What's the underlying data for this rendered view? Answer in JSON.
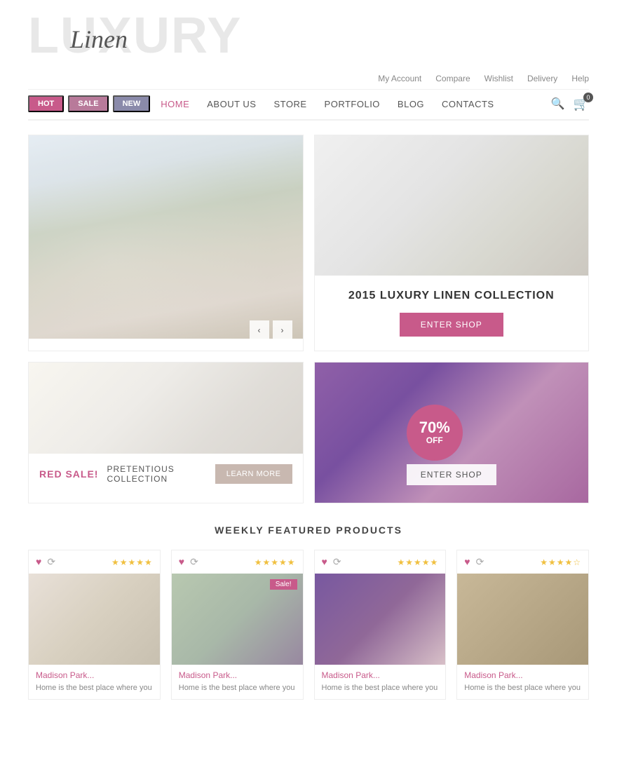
{
  "header": {
    "logo_bg": "LUXURY",
    "logo_script": "Linen"
  },
  "topbar": {
    "items": [
      "My Account",
      "Compare",
      "Wishlist",
      "Delivery",
      "Help"
    ]
  },
  "nav": {
    "badges": [
      {
        "label": "HOT",
        "class": "badge-hot"
      },
      {
        "label": "SALE",
        "class": "badge-sale"
      },
      {
        "label": "NEW",
        "class": "badge-new"
      }
    ],
    "links": [
      {
        "label": "HOME",
        "active": true
      },
      {
        "label": "ABOUT US"
      },
      {
        "label": "STORE"
      },
      {
        "label": "PORTFOLIO"
      },
      {
        "label": "BLOG"
      },
      {
        "label": "CONTACTS"
      }
    ],
    "cart_count": "0"
  },
  "hero": {
    "collection_title": "2015 LUXURY LINEN COLLECTION",
    "enter_shop_label": "ENTER SHOP"
  },
  "promo": {
    "red_sale_label": "RED SALE!",
    "promo_desc": "PRETENTIOUS COLLECTION",
    "learn_more_label": "LEARN MORE",
    "discount_pct": "70%",
    "discount_off": "OFF",
    "enter_shop_label": "ENTER SHOP"
  },
  "weekly": {
    "section_title": "WEEKLY FEATURED PRODUCTS",
    "products": [
      {
        "name": "Madison Park...",
        "desc": "Home is the best place where you",
        "stars": "★★★★★",
        "img_class": "product-img",
        "sale": false
      },
      {
        "name": "Madison Park...",
        "desc": "Home is the best place where you",
        "stars": "★★★★★",
        "img_class": "product-img green",
        "sale": true,
        "sale_label": "Sale!"
      },
      {
        "name": "Madison Park...",
        "desc": "Home is the best place where you",
        "stars": "★★★★★",
        "img_class": "product-img purple",
        "sale": false
      },
      {
        "name": "Madison Park...",
        "desc": "Home is the best place where you",
        "stars": "★★★★☆",
        "img_class": "product-img dark",
        "sale": false
      }
    ]
  }
}
